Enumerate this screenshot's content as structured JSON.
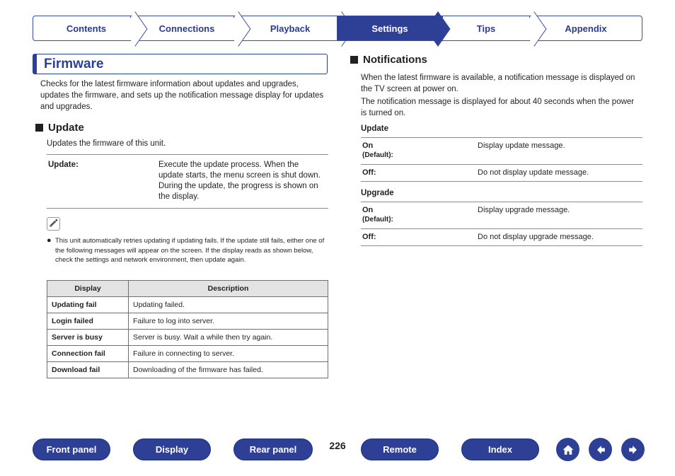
{
  "tabs": [
    {
      "label": "Contents",
      "active": false
    },
    {
      "label": "Connections",
      "active": false
    },
    {
      "label": "Playback",
      "active": false
    },
    {
      "label": "Settings",
      "active": true
    },
    {
      "label": "Tips",
      "active": false
    },
    {
      "label": "Appendix",
      "active": false
    }
  ],
  "page_title": "Firmware",
  "intro": "Checks for the latest firmware information about updates and upgrades, updates the firmware, and sets up the notification message display for updates and upgrades.",
  "left": {
    "update_heading": "Update",
    "update_sub": "Updates the firmware of this unit.",
    "update_table": [
      {
        "key": "Update:",
        "value": "Execute the update process. When the update starts, the menu screen is shut down. During the update, the progress is shown on the display."
      }
    ],
    "note_icon": "pencil-icon",
    "note_bullet": "●",
    "note_text": "This unit automatically retries updating if updating fails. If the update still fails, either one of the following messages will appear on the screen. If the display reads as shown below, check the settings and network environment, then update again.",
    "display_table": {
      "headers": [
        "Display",
        "Description"
      ],
      "rows": [
        [
          "Updating fail",
          "Updating failed."
        ],
        [
          "Login failed",
          "Failure to log into server."
        ],
        [
          "Server is busy",
          "Server is busy. Wait a while then try again."
        ],
        [
          "Connection fail",
          "Failure in connecting to server."
        ],
        [
          "Download fail",
          "Downloading of the firmware has failed."
        ]
      ]
    }
  },
  "right": {
    "notifications_heading": "Notifications",
    "para1": "When the latest firmware is available, a notification message is displayed on the TV screen at power on.",
    "para2": "The notification message is displayed for about 40 seconds when the power is turned on.",
    "update_sub_heading": "Update",
    "update_rows": [
      {
        "key": "On",
        "default": "(Default):",
        "value": "Display update message."
      },
      {
        "key": "Off:",
        "default": "",
        "value": "Do not display update message."
      }
    ],
    "upgrade_sub_heading": "Upgrade",
    "upgrade_rows": [
      {
        "key": "On",
        "default": "(Default):",
        "value": "Display upgrade message."
      },
      {
        "key": "Off:",
        "default": "",
        "value": "Do not display upgrade message."
      }
    ]
  },
  "footer": {
    "buttons": [
      "Front panel",
      "Display",
      "Rear panel",
      "Remote",
      "Index"
    ],
    "page_number": "226",
    "icons": [
      "home-icon",
      "back-arrow-icon",
      "forward-arrow-icon"
    ]
  },
  "colors": {
    "accent": "#2e3f96",
    "text": "#231f20",
    "rule": "#8c8c8c"
  }
}
